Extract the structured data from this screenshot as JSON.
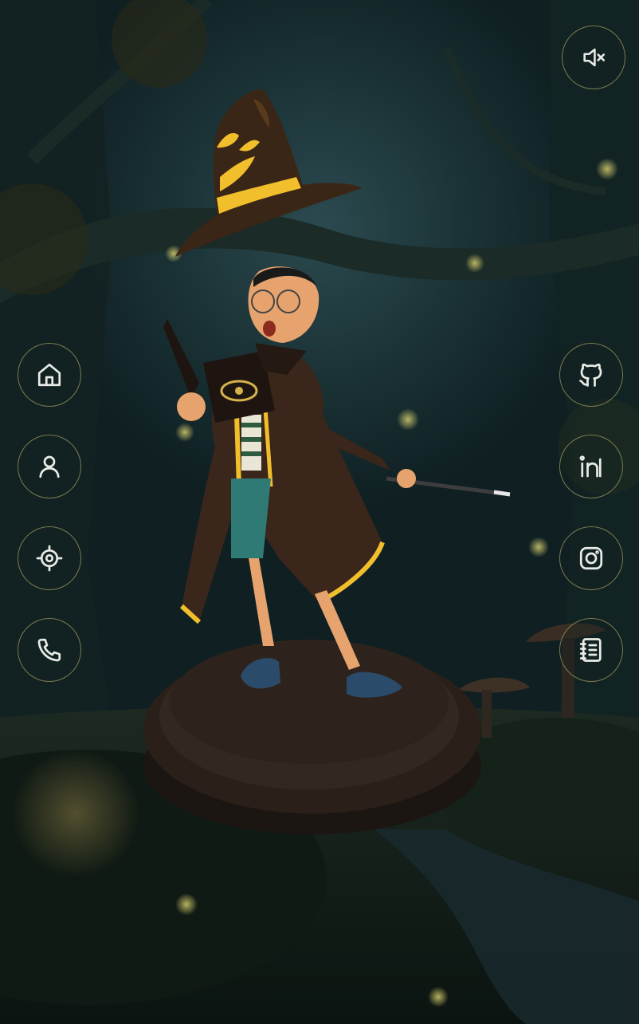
{
  "page": {
    "accent_color": "#d6c478",
    "icon_color": "#e9ece6"
  },
  "top_right": {
    "icon": "sound-muted-icon"
  },
  "left_nav": [
    {
      "icon": "home-icon"
    },
    {
      "icon": "user-icon"
    },
    {
      "icon": "target-icon"
    },
    {
      "icon": "phone-icon"
    }
  ],
  "right_nav": [
    {
      "icon": "github-icon"
    },
    {
      "icon": "linkedin-icon"
    },
    {
      "icon": "instagram-icon"
    },
    {
      "icon": "notebook-icon"
    }
  ]
}
